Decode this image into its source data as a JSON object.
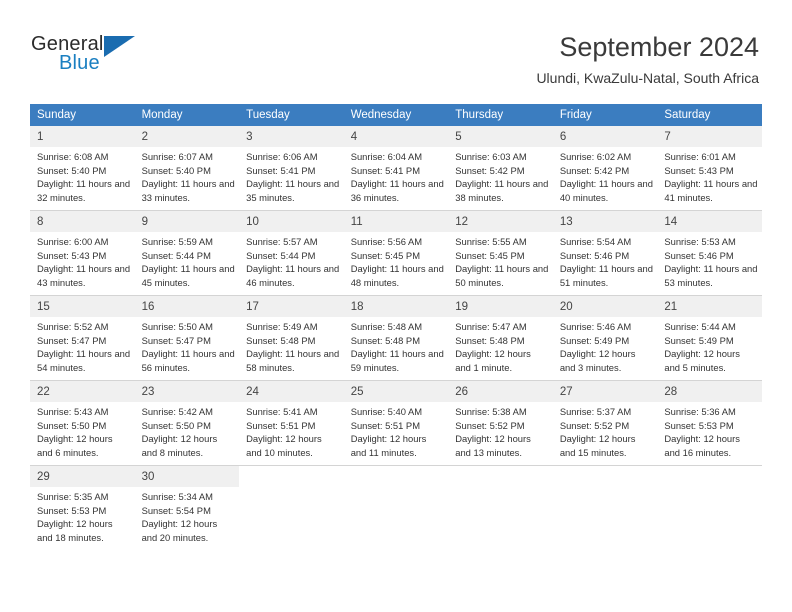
{
  "brand": {
    "name_part1": "General",
    "name_part2": "Blue",
    "flag_icon": "triangle-flag-icon",
    "accent_color": "#1a7fc1"
  },
  "header": {
    "title": "September 2024",
    "location": "Ulundi, KwaZulu-Natal, South Africa"
  },
  "calendar": {
    "header_bg_color": "#3b7dc0",
    "daynum_bg_color": "#f0f0f0",
    "columns": [
      "Sunday",
      "Monday",
      "Tuesday",
      "Wednesday",
      "Thursday",
      "Friday",
      "Saturday"
    ],
    "weeks": [
      [
        {
          "day": "1",
          "sunrise": "Sunrise: 6:08 AM",
          "sunset": "Sunset: 5:40 PM",
          "daylight": "Daylight: 11 hours and 32 minutes."
        },
        {
          "day": "2",
          "sunrise": "Sunrise: 6:07 AM",
          "sunset": "Sunset: 5:40 PM",
          "daylight": "Daylight: 11 hours and 33 minutes."
        },
        {
          "day": "3",
          "sunrise": "Sunrise: 6:06 AM",
          "sunset": "Sunset: 5:41 PM",
          "daylight": "Daylight: 11 hours and 35 minutes."
        },
        {
          "day": "4",
          "sunrise": "Sunrise: 6:04 AM",
          "sunset": "Sunset: 5:41 PM",
          "daylight": "Daylight: 11 hours and 36 minutes."
        },
        {
          "day": "5",
          "sunrise": "Sunrise: 6:03 AM",
          "sunset": "Sunset: 5:42 PM",
          "daylight": "Daylight: 11 hours and 38 minutes."
        },
        {
          "day": "6",
          "sunrise": "Sunrise: 6:02 AM",
          "sunset": "Sunset: 5:42 PM",
          "daylight": "Daylight: 11 hours and 40 minutes."
        },
        {
          "day": "7",
          "sunrise": "Sunrise: 6:01 AM",
          "sunset": "Sunset: 5:43 PM",
          "daylight": "Daylight: 11 hours and 41 minutes."
        }
      ],
      [
        {
          "day": "8",
          "sunrise": "Sunrise: 6:00 AM",
          "sunset": "Sunset: 5:43 PM",
          "daylight": "Daylight: 11 hours and 43 minutes."
        },
        {
          "day": "9",
          "sunrise": "Sunrise: 5:59 AM",
          "sunset": "Sunset: 5:44 PM",
          "daylight": "Daylight: 11 hours and 45 minutes."
        },
        {
          "day": "10",
          "sunrise": "Sunrise: 5:57 AM",
          "sunset": "Sunset: 5:44 PM",
          "daylight": "Daylight: 11 hours and 46 minutes."
        },
        {
          "day": "11",
          "sunrise": "Sunrise: 5:56 AM",
          "sunset": "Sunset: 5:45 PM",
          "daylight": "Daylight: 11 hours and 48 minutes."
        },
        {
          "day": "12",
          "sunrise": "Sunrise: 5:55 AM",
          "sunset": "Sunset: 5:45 PM",
          "daylight": "Daylight: 11 hours and 50 minutes."
        },
        {
          "day": "13",
          "sunrise": "Sunrise: 5:54 AM",
          "sunset": "Sunset: 5:46 PM",
          "daylight": "Daylight: 11 hours and 51 minutes."
        },
        {
          "day": "14",
          "sunrise": "Sunrise: 5:53 AM",
          "sunset": "Sunset: 5:46 PM",
          "daylight": "Daylight: 11 hours and 53 minutes."
        }
      ],
      [
        {
          "day": "15",
          "sunrise": "Sunrise: 5:52 AM",
          "sunset": "Sunset: 5:47 PM",
          "daylight": "Daylight: 11 hours and 54 minutes."
        },
        {
          "day": "16",
          "sunrise": "Sunrise: 5:50 AM",
          "sunset": "Sunset: 5:47 PM",
          "daylight": "Daylight: 11 hours and 56 minutes."
        },
        {
          "day": "17",
          "sunrise": "Sunrise: 5:49 AM",
          "sunset": "Sunset: 5:48 PM",
          "daylight": "Daylight: 11 hours and 58 minutes."
        },
        {
          "day": "18",
          "sunrise": "Sunrise: 5:48 AM",
          "sunset": "Sunset: 5:48 PM",
          "daylight": "Daylight: 11 hours and 59 minutes."
        },
        {
          "day": "19",
          "sunrise": "Sunrise: 5:47 AM",
          "sunset": "Sunset: 5:48 PM",
          "daylight": "Daylight: 12 hours and 1 minute."
        },
        {
          "day": "20",
          "sunrise": "Sunrise: 5:46 AM",
          "sunset": "Sunset: 5:49 PM",
          "daylight": "Daylight: 12 hours and 3 minutes."
        },
        {
          "day": "21",
          "sunrise": "Sunrise: 5:44 AM",
          "sunset": "Sunset: 5:49 PM",
          "daylight": "Daylight: 12 hours and 5 minutes."
        }
      ],
      [
        {
          "day": "22",
          "sunrise": "Sunrise: 5:43 AM",
          "sunset": "Sunset: 5:50 PM",
          "daylight": "Daylight: 12 hours and 6 minutes."
        },
        {
          "day": "23",
          "sunrise": "Sunrise: 5:42 AM",
          "sunset": "Sunset: 5:50 PM",
          "daylight": "Daylight: 12 hours and 8 minutes."
        },
        {
          "day": "24",
          "sunrise": "Sunrise: 5:41 AM",
          "sunset": "Sunset: 5:51 PM",
          "daylight": "Daylight: 12 hours and 10 minutes."
        },
        {
          "day": "25",
          "sunrise": "Sunrise: 5:40 AM",
          "sunset": "Sunset: 5:51 PM",
          "daylight": "Daylight: 12 hours and 11 minutes."
        },
        {
          "day": "26",
          "sunrise": "Sunrise: 5:38 AM",
          "sunset": "Sunset: 5:52 PM",
          "daylight": "Daylight: 12 hours and 13 minutes."
        },
        {
          "day": "27",
          "sunrise": "Sunrise: 5:37 AM",
          "sunset": "Sunset: 5:52 PM",
          "daylight": "Daylight: 12 hours and 15 minutes."
        },
        {
          "day": "28",
          "sunrise": "Sunrise: 5:36 AM",
          "sunset": "Sunset: 5:53 PM",
          "daylight": "Daylight: 12 hours and 16 minutes."
        }
      ],
      [
        {
          "day": "29",
          "sunrise": "Sunrise: 5:35 AM",
          "sunset": "Sunset: 5:53 PM",
          "daylight": "Daylight: 12 hours and 18 minutes."
        },
        {
          "day": "30",
          "sunrise": "Sunrise: 5:34 AM",
          "sunset": "Sunset: 5:54 PM",
          "daylight": "Daylight: 12 hours and 20 minutes."
        },
        {
          "day": "",
          "sunrise": "",
          "sunset": "",
          "daylight": ""
        },
        {
          "day": "",
          "sunrise": "",
          "sunset": "",
          "daylight": ""
        },
        {
          "day": "",
          "sunrise": "",
          "sunset": "",
          "daylight": ""
        },
        {
          "day": "",
          "sunrise": "",
          "sunset": "",
          "daylight": ""
        },
        {
          "day": "",
          "sunrise": "",
          "sunset": "",
          "daylight": ""
        }
      ]
    ]
  }
}
